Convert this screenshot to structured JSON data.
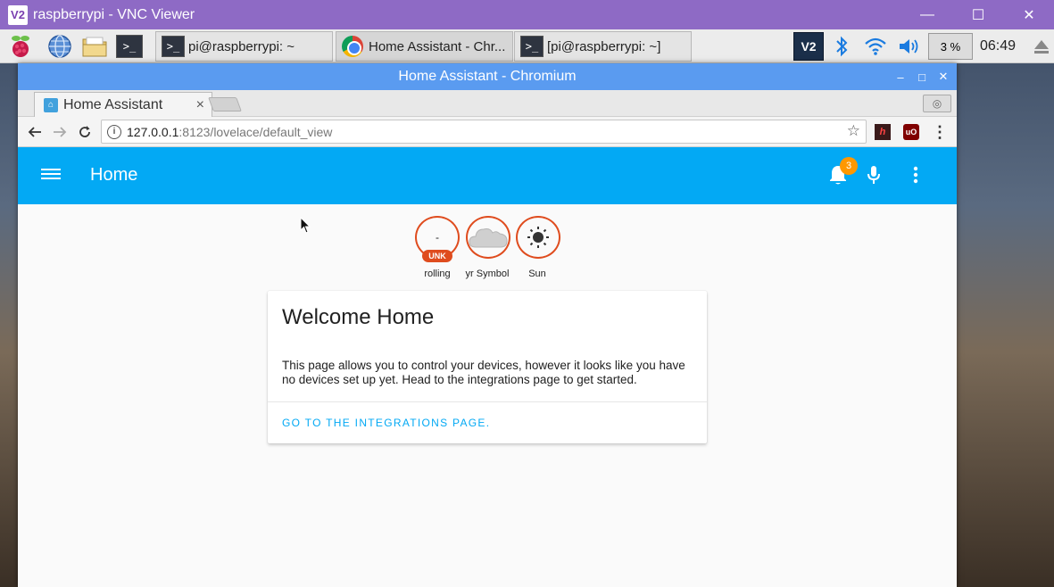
{
  "vnc": {
    "logo": "V2",
    "title": "raspberrypi - VNC Viewer",
    "minimize": "—",
    "maximize": "☐",
    "close": "✕"
  },
  "taskbar": {
    "icons": [
      "raspberry-menu-icon",
      "web-browser-icon",
      "file-manager-icon",
      "terminal-icon"
    ],
    "terminal_glyph": ">_",
    "tasks": [
      {
        "label": "pi@raspberrypi: ~",
        "icon": "terminal-icon"
      },
      {
        "label": "Home Assistant - Chr...",
        "icon": "chromium-icon"
      },
      {
        "label": "[pi@raspberrypi: ~]",
        "icon": "terminal-icon"
      }
    ],
    "tray": {
      "vnc": "V2",
      "cpu": "3 %",
      "clock": "06:49"
    }
  },
  "chromium": {
    "window_title": "Home Assistant - Chromium",
    "controls": {
      "minimize": "–",
      "maximize": "□",
      "close": "✕"
    },
    "tab": {
      "title": "Home Assistant",
      "close": "×"
    },
    "url_host": "127.0.0.1",
    "url_path": ":8123/lovelace/default_view",
    "ext_h": "h",
    "ext_ub": "uO"
  },
  "ha": {
    "header_title": "Home",
    "notifications_count": "3",
    "badges": [
      {
        "value": "-",
        "status": "UNK",
        "label": "rolling"
      },
      {
        "label": "yr Symbol",
        "icon": "cloud-icon"
      },
      {
        "label": "Sun",
        "icon": "sun-icon"
      }
    ],
    "card": {
      "title": "Welcome Home",
      "text": "This page allows you to control your devices, however it looks like you have no devices set up yet. Head to the integrations page to get started.",
      "action": "GO TO THE INTEGRATIONS PAGE."
    }
  },
  "colors": {
    "ha_primary": "#03a9f4",
    "badge_border": "#df4c1e",
    "notification_badge": "#ff9800",
    "vnc_title_bar": "#8e6ac5",
    "chromium_title_bar": "#5a9bf0"
  }
}
